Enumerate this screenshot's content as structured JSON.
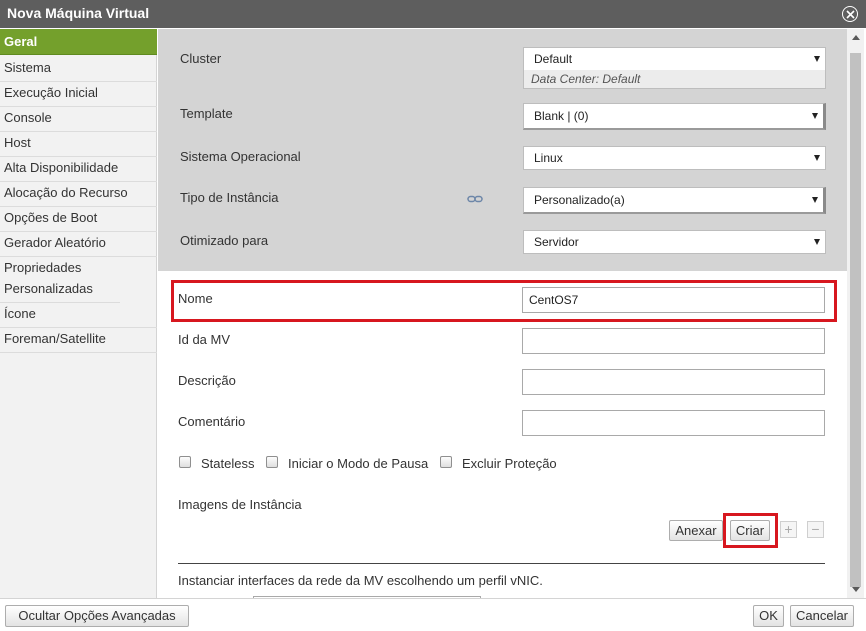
{
  "window": {
    "title": "Nova Máquina Virtual",
    "close_icon": "close-icon"
  },
  "colors": {
    "titlebar": "#5e5e5e",
    "active_tab": "#74a02c",
    "highlight_box": "#d7171f",
    "grey_panel": "#d4d4d4"
  },
  "sidebar": {
    "items": [
      {
        "label": "Geral",
        "active": true
      },
      {
        "label": "Sistema"
      },
      {
        "label": "Execução Inicial"
      },
      {
        "label": "Console"
      },
      {
        "label": "Host"
      },
      {
        "label": "Alta Disponibilidade"
      },
      {
        "label": "Alocação do Recurso"
      },
      {
        "label": "Opções de Boot"
      },
      {
        "label": "Gerador Aleatório"
      },
      {
        "label": "Propriedades Personalizadas"
      },
      {
        "label": "Ícone"
      },
      {
        "label": "Foreman/Satellite"
      }
    ]
  },
  "form": {
    "cluster": {
      "label": "Cluster",
      "value": "Default",
      "note": "Data Center: Default"
    },
    "template": {
      "label": "Template",
      "value": "Blank | (0)"
    },
    "os": {
      "label": "Sistema Operacional",
      "value": "Linux"
    },
    "instance_type": {
      "label": "Tipo de Instância",
      "value": "Personalizado(a)",
      "link_icon": "chain-link-icon"
    },
    "optimized": {
      "label": "Otimizado para",
      "value": "Servidor"
    },
    "name": {
      "label": "Nome",
      "value": "CentOS7"
    },
    "vm_id": {
      "label": "Id da MV",
      "value": ""
    },
    "description": {
      "label": "Descrição",
      "value": ""
    },
    "comment": {
      "label": "Comentário",
      "value": ""
    },
    "checkboxes": {
      "stateless": {
        "label": "Stateless",
        "checked": false
      },
      "pause_mode": {
        "label": "Iniciar o Modo de Pausa",
        "checked": false
      },
      "delete_protection": {
        "label": "Excluir Proteção",
        "checked": false
      }
    },
    "instance_images": {
      "label": "Imagens de Instância",
      "attach_button": "Anexar",
      "create_button": "Criar",
      "plus_button": "+",
      "minus_button": "−"
    },
    "vnic_text": "Instanciar interfaces da rede da MV escolhendo um perfil vNIC."
  },
  "footer": {
    "advanced_button": "Ocultar Opções Avançadas",
    "ok_button": "OK",
    "cancel_button": "Cancelar"
  }
}
